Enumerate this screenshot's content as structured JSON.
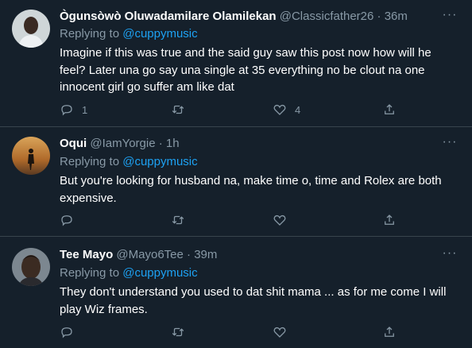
{
  "tweets": [
    {
      "name": "Ògunsòwò Oluwadamilare Olamilekan",
      "handle": "@Classicfather26",
      "dot": "·",
      "time": "36m",
      "replying_prefix": "Replying to",
      "replying_to": "@cuppymusic",
      "text": "Imagine if this was true and the said guy saw this post now how will he feel? Later una go say una single at 35 everything no be clout na one innocent girl go suffer am like dat",
      "reply_count": "1",
      "retweet_count": "",
      "like_count": "4"
    },
    {
      "name": "Oqui",
      "handle": "@IamYorgie",
      "dot": "·",
      "time": "1h",
      "replying_prefix": "Replying to",
      "replying_to": "@cuppymusic",
      "text": "But you're looking for husband na, make time o, time and Rolex are both expensive.",
      "reply_count": "",
      "retweet_count": "",
      "like_count": ""
    },
    {
      "name": "Tee Mayo",
      "handle": "@Mayo6Tee",
      "dot": "·",
      "time": "39m",
      "replying_prefix": "Replying to",
      "replying_to": "@cuppymusic",
      "text": "They don't understand  you used to dat shit mama ... as for me come I will play Wiz frames.",
      "reply_count": "",
      "retweet_count": "",
      "like_count": ""
    }
  ],
  "icons": {
    "reply": "reply-icon",
    "retweet": "retweet-icon",
    "like": "heart-icon",
    "share": "share-icon",
    "more": "more-icon"
  },
  "colors": {
    "background": "#15202b",
    "divider": "#38444d",
    "secondary_text": "#8899a6",
    "mention": "#1da1f2",
    "primary_text": "#ffffff"
  }
}
